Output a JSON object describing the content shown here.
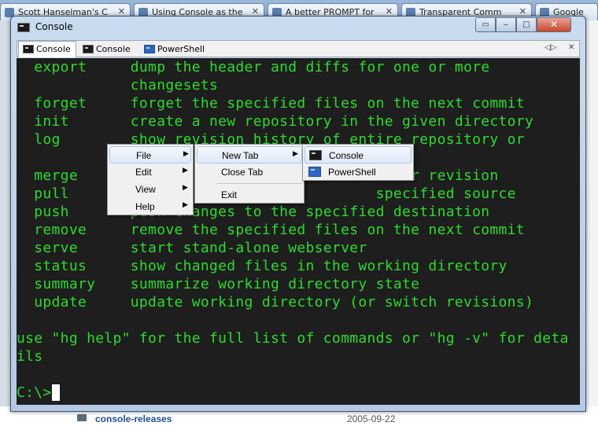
{
  "background": {
    "browser_tabs": [
      "Scott Hanselman's C",
      "Using Console as the",
      "A better PROMPT for",
      "Transparent Comm",
      "Google"
    ],
    "folder_link": "console-releases",
    "folder_date": "2005-09-22"
  },
  "window": {
    "title": "Console",
    "tabs": [
      {
        "label": "Console",
        "icon": "console-icon",
        "active": true
      },
      {
        "label": "Console",
        "icon": "console-icon",
        "active": false
      },
      {
        "label": "PowerShell",
        "icon": "powershell-icon",
        "active": false
      }
    ]
  },
  "terminal": {
    "lines": [
      "  export     dump the header and diffs for one or more",
      "             changesets",
      "  forget     forget the specified files on the next commit",
      "  init       create a new repository in the given directory",
      "  log        show revision history of entire repository or",
      "",
      "  merge                                     er revision",
      "  pull                                   specified source",
      "  push       push changes to the specified destination",
      "  remove     remove the specified files on the next commit",
      "  serve      start stand-alone webserver",
      "  status     show changed files in the working directory",
      "  summary    summarize working directory state",
      "  update     update working directory (or switch revisions)",
      "",
      "use \"hg help\" for the full list of commands or \"hg -v\" for deta",
      "ils",
      "",
      "C:\\>"
    ],
    "text_color": "#2bdc2b",
    "background": "#1e1e1e"
  },
  "context_menu": {
    "main": [
      "File",
      "Edit",
      "View",
      "Help"
    ],
    "file_submenu": [
      "New Tab",
      "Close Tab",
      "Exit"
    ],
    "new_tab_submenu": [
      "Console",
      "PowerShell"
    ]
  }
}
